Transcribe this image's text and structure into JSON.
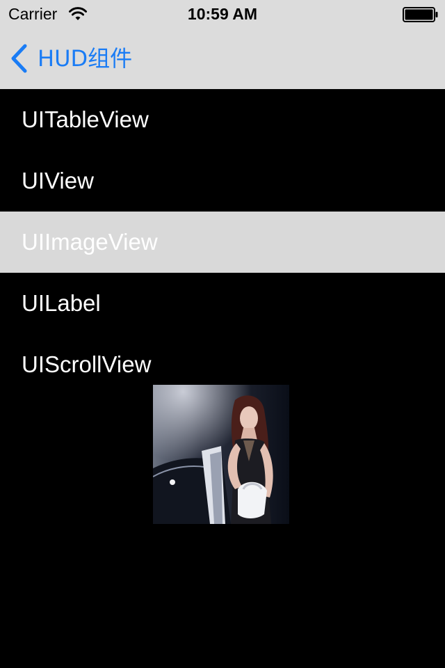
{
  "status_bar": {
    "carrier": "Carrier",
    "time": "10:59 AM",
    "wifi_icon": "wifi-icon",
    "battery_icon": "battery-icon"
  },
  "nav_bar": {
    "back_label": "HUD组件",
    "back_icon": "chevron-left-icon",
    "tint_color": "#1a7cf5"
  },
  "table": {
    "items": [
      {
        "label": "UITableView",
        "selected": false
      },
      {
        "label": "UIView",
        "selected": false
      },
      {
        "label": "UIImageView",
        "selected": true
      },
      {
        "label": "UILabel",
        "selected": false
      },
      {
        "label": "UIScrollView",
        "selected": false
      }
    ],
    "selected_background": "#d9d9d9"
  },
  "hud_image": {
    "subject": "photo-of-woman-by-car"
  }
}
